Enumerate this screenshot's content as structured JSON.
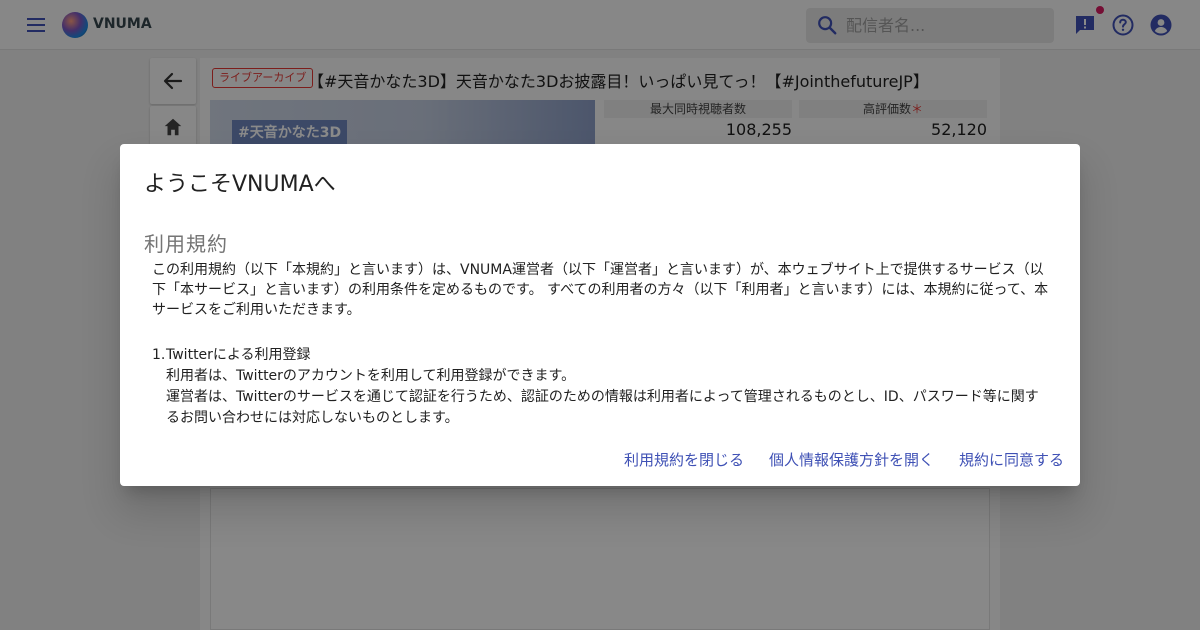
{
  "header": {
    "brand": "VNUMA",
    "search_placeholder": "配信者名..."
  },
  "video": {
    "live_chip": "ライブアーカイブ",
    "title": "【#天音かなた3D】天音かなた3Dお披露目！いっぱい見てっ！【#JointhefutureJP】",
    "thumbnail_text": "#天音かなた3D",
    "stats": [
      {
        "label": "最大同時視聴者数",
        "value": "108,255"
      },
      {
        "label": "高評価数",
        "value": "52,120"
      }
    ]
  },
  "dialog": {
    "title": "ようこそVNUMAへ",
    "section_title": "利用規約",
    "intro": "この利用規約（以下「本規約」と言います）は、VNUMA運営者（以下「運営者」と言います）が、本ウェブサイト上で提供するサービス（以下「本サービス」と言います）の利用条件を定めるものです。 すべての利用者の方々（以下「利用者」と言います）には、本規約に従って、本サービスをご利用いただきます。",
    "terms": [
      {
        "number": "1.",
        "heading": "Twitterによる利用登録",
        "line1": "利用者は、Twitterのアカウントを利用して利用登録ができます。",
        "line2": "運営者は、Twitterのサービスを通じて認証を行うため、認証のための情報は利用者によって管理されるものとし、ID、パスワード等に関するお問い合わせには対応しないものとします。"
      }
    ],
    "actions": {
      "close_terms": "利用規約を閉じる",
      "open_privacy": "個人情報保護方針を開く",
      "agree": "規約に同意する"
    }
  },
  "colors": {
    "accent": "#3f51b5",
    "live": "#e53935",
    "notification": "#d81b60"
  }
}
